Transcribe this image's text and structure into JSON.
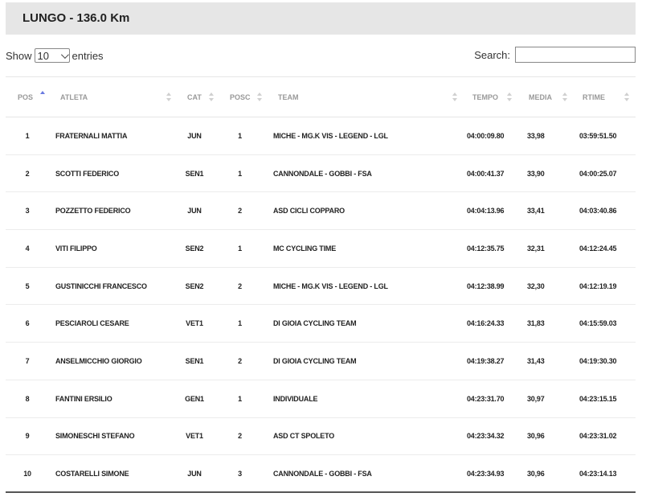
{
  "page": {
    "title": "LUNGO - 136.0 Km"
  },
  "controls": {
    "show_label": "Show",
    "entries_value": "10",
    "entries_label": "entries",
    "search_label": "Search:",
    "search_value": ""
  },
  "table": {
    "headers": {
      "pos": "POS",
      "atleta": "ATLETA",
      "cat": "CAT",
      "posc": "POSC",
      "team": "TEAM",
      "tempo": "TEMPO",
      "media": "MEDIA",
      "rtime": "RTIME"
    },
    "rows": [
      {
        "pos": "1",
        "atleta": "FRATERNALI MATTIA",
        "cat": "JUN",
        "posc": "1",
        "team": "MICHE - MG.K VIS - LEGEND - LGL",
        "tempo": "04:00:09.80",
        "media": "33,98",
        "rtime": "03:59:51.50"
      },
      {
        "pos": "2",
        "atleta": "SCOTTI FEDERICO",
        "cat": "SEN1",
        "posc": "1",
        "team": "CANNONDALE - GOBBI - FSA",
        "tempo": "04:00:41.37",
        "media": "33,90",
        "rtime": "04:00:25.07"
      },
      {
        "pos": "3",
        "atleta": "POZZETTO FEDERICO",
        "cat": "JUN",
        "posc": "2",
        "team": "ASD CICLI COPPARO",
        "tempo": "04:04:13.96",
        "media": "33,41",
        "rtime": "04:03:40.86"
      },
      {
        "pos": "4",
        "atleta": "VITI FILIPPO",
        "cat": "SEN2",
        "posc": "1",
        "team": "MC CYCLING TIME",
        "tempo": "04:12:35.75",
        "media": "32,31",
        "rtime": "04:12:24.45"
      },
      {
        "pos": "5",
        "atleta": "GUSTINICCHI FRANCESCO",
        "cat": "SEN2",
        "posc": "2",
        "team": "MICHE - MG.K VIS - LEGEND - LGL",
        "tempo": "04:12:38.99",
        "media": "32,30",
        "rtime": "04:12:19.19"
      },
      {
        "pos": "6",
        "atleta": "PESCIAROLI CESARE",
        "cat": "VET1",
        "posc": "1",
        "team": "DI GIOIA CYCLING TEAM",
        "tempo": "04:16:24.33",
        "media": "31,83",
        "rtime": "04:15:59.03"
      },
      {
        "pos": "7",
        "atleta": "ANSELMICCHIO GIORGIO",
        "cat": "SEN1",
        "posc": "2",
        "team": "DI GIOIA CYCLING TEAM",
        "tempo": "04:19:38.27",
        "media": "31,43",
        "rtime": "04:19:30.30"
      },
      {
        "pos": "8",
        "atleta": "FANTINI ERSILIO",
        "cat": "GEN1",
        "posc": "1",
        "team": "INDIVIDUALE",
        "tempo": "04:23:31.70",
        "media": "30,97",
        "rtime": "04:23:15.15"
      },
      {
        "pos": "9",
        "atleta": "SIMONESCHI STEFANO",
        "cat": "VET1",
        "posc": "2",
        "team": "ASD CT SPOLETO",
        "tempo": "04:23:34.32",
        "media": "30,96",
        "rtime": "04:23:31.02"
      },
      {
        "pos": "10",
        "atleta": "COSTARELLI SIMONE",
        "cat": "JUN",
        "posc": "3",
        "team": "CANNONDALE - GOBBI - FSA",
        "tempo": "04:23:34.93",
        "media": "30,96",
        "rtime": "04:23:14.13"
      }
    ]
  }
}
